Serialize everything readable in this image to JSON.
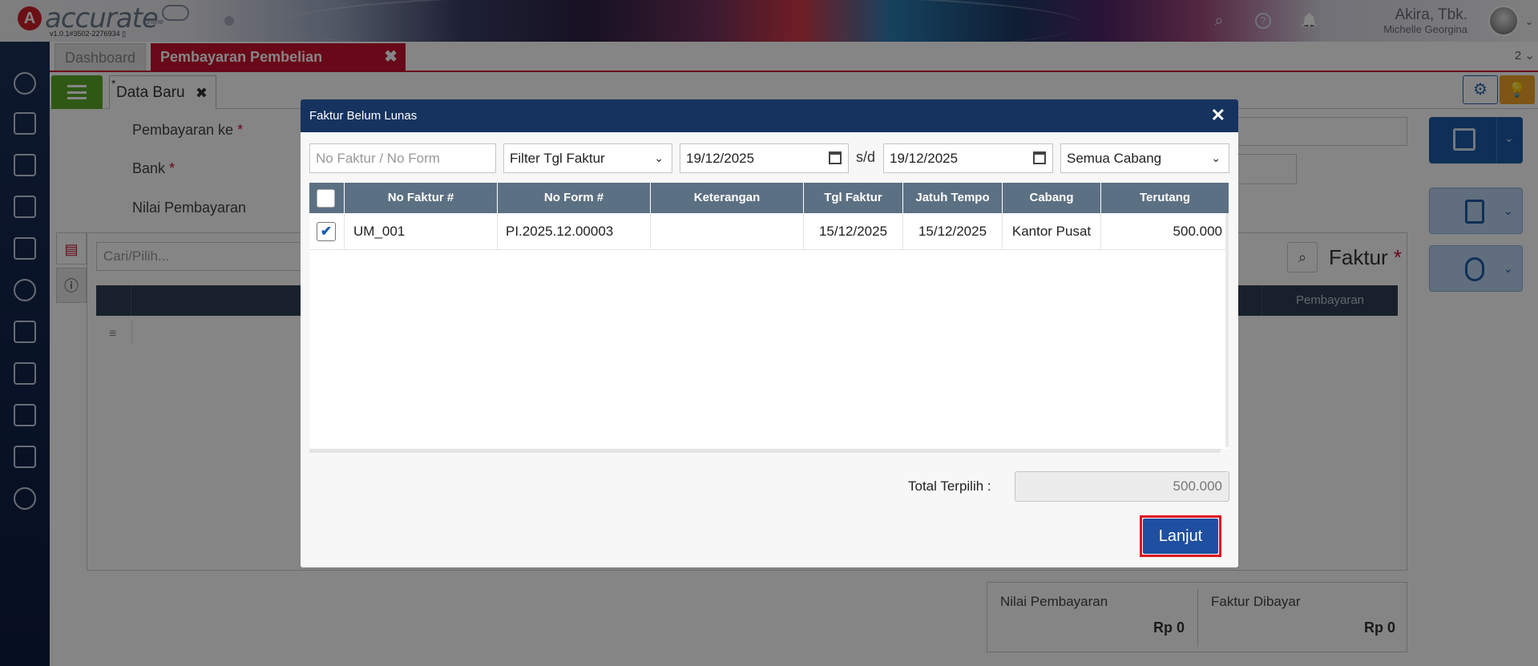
{
  "app": {
    "logo_mark": "A",
    "logo_text": "accurate",
    "logo_sub": "online",
    "version": "v1.0.1#3502-2276934 ▯",
    "company": "Akira, Tbk.",
    "user": "Michelle Georgina"
  },
  "tabs": {
    "dashboard": "Dashboard",
    "active": "Pembayaran Pembelian",
    "close": "✖",
    "count": "2 ⌄"
  },
  "subtabs": {
    "asterisk": "*",
    "data_baru": "Data Baru",
    "close": "✖"
  },
  "form": {
    "pembayaran_ke": "Pembayaran ke",
    "bank": "Bank",
    "nilai_pembayaran": "Nilai Pembayaran",
    "required": "*"
  },
  "detail": {
    "search_placeholder": "Cari/Pilih...",
    "section_title": "Faktur",
    "required": "*",
    "col_pembayaran": "Pembayaran"
  },
  "totals": {
    "nilai_pembayaran_label": "Nilai Pembayaran",
    "nilai_pembayaran_value": "Rp 0",
    "faktur_dibayar_label": "Faktur Dibayar",
    "faktur_dibayar_value": "Rp 0"
  },
  "modal": {
    "title": "Faktur Belum Lunas",
    "close": "✕",
    "search_placeholder": "No Faktur / No Form",
    "filter_select": "Filter Tgl Faktur",
    "date_from": "19/12/2025",
    "date_sep": "s/d",
    "date_to": "19/12/2025",
    "branch_select": "Semua Cabang",
    "columns": [
      "No Faktur #",
      "No Form #",
      "Keterangan",
      "Tgl Faktur",
      "Jatuh Tempo",
      "Cabang",
      "Terutang"
    ],
    "rows": [
      {
        "checked": "✔",
        "no_faktur": "UM_001",
        "no_form": "PI.2025.12.00003",
        "keterangan": "",
        "tgl_faktur": "15/12/2025",
        "jatuh_tempo": "15/12/2025",
        "cabang": "Kantor Pusat",
        "terutang": "500.000"
      }
    ],
    "total_label": "Total Terpilih :",
    "total_value": "500.000",
    "continue_button": "Lanjut"
  },
  "icons": {
    "search": "⌕",
    "help": "?",
    "bell": "🔔",
    "gear": "⚙",
    "bulb": "💡",
    "caret": "⌄",
    "menu": "≡",
    "info": "ⓘ",
    "doc": "▤"
  },
  "colors": {
    "brand_red": "#c8102e",
    "modal_header": "#16335f",
    "table_header": "#5c7083",
    "primary_button": "#1e4fa0",
    "sidebar": "#13254a"
  }
}
